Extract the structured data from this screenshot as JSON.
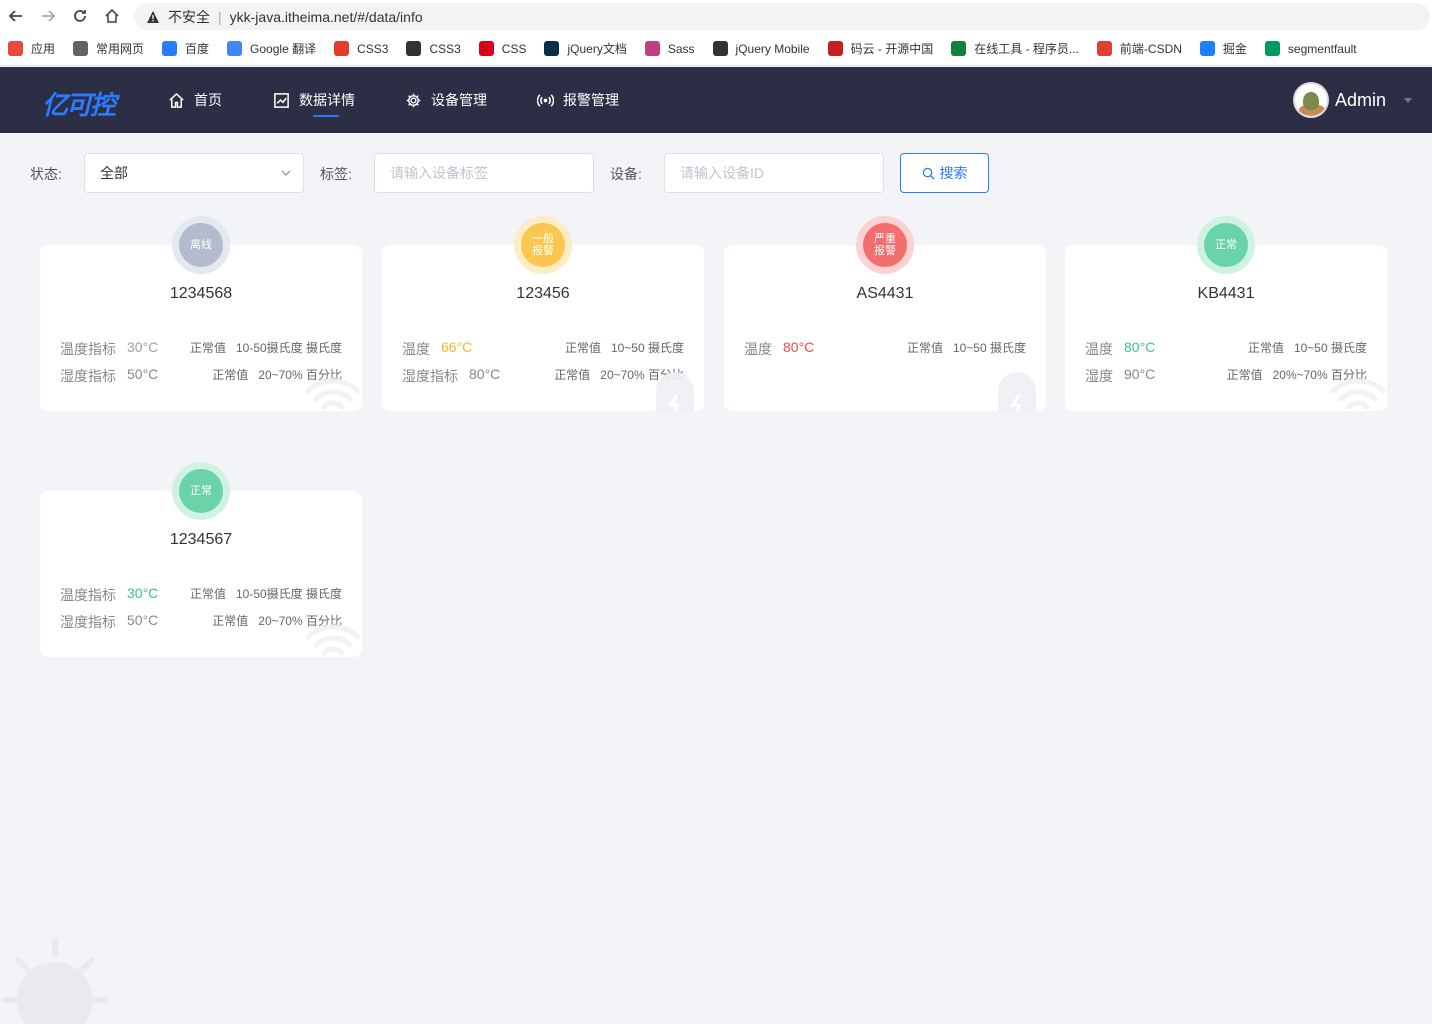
{
  "browser": {
    "insecure_label": "不安全",
    "url": "ykk-java.itheima.net/#/data/info",
    "bookmarks": [
      {
        "label": "应用",
        "icon": "apps-grid-icon",
        "color": "#e84a3c"
      },
      {
        "label": "常用网页",
        "icon": "folder-icon",
        "color": "#5f6368"
      },
      {
        "label": "百度",
        "icon": "baidu-paw-icon",
        "color": "#2a7bff"
      },
      {
        "label": "Google 翻译",
        "icon": "google-translate-icon",
        "color": "#4285f4"
      },
      {
        "label": "CSS3",
        "icon": "html5-icon",
        "color": "#e43b2c"
      },
      {
        "label": "CSS3",
        "icon": "globe-icon",
        "color": "#333333"
      },
      {
        "label": "CSS",
        "icon": "b-logo-icon",
        "color": "#d8001a"
      },
      {
        "label": "jQuery文档",
        "icon": "jquery-icon",
        "color": "#0b2d4a"
      },
      {
        "label": "Sass",
        "icon": "sass-icon",
        "color": "#bf4080"
      },
      {
        "label": "jQuery Mobile",
        "icon": "globe-icon",
        "color": "#333333"
      },
      {
        "label": "码云 - 开源中国",
        "icon": "gitee-icon",
        "color": "#c71d23"
      },
      {
        "label": "在线工具 - 程序员...",
        "icon": "tool-icon",
        "color": "#11823b"
      },
      {
        "label": "前端-CSDN",
        "icon": "csdn-icon",
        "color": "#e33e33"
      },
      {
        "label": "掘金",
        "icon": "juejin-icon",
        "color": "#1e80ff"
      },
      {
        "label": "segmentfault",
        "icon": "sf-icon",
        "color": "#009a61"
      }
    ]
  },
  "header": {
    "logo": "亿可控",
    "nav": [
      {
        "label": "首页",
        "icon": "home-icon"
      },
      {
        "label": "数据详情",
        "icon": "chart-icon",
        "active": true
      },
      {
        "label": "设备管理",
        "icon": "gear-icon"
      },
      {
        "label": "报警管理",
        "icon": "broadcast-icon"
      }
    ],
    "user": "Admin"
  },
  "filters": {
    "status_label": "状态:",
    "status_value": "全部",
    "tag_label": "标签:",
    "tag_placeholder": "请输入设备标签",
    "device_label": "设备:",
    "device_placeholder": "请输入设备ID",
    "search_label": "搜索"
  },
  "cards": [
    {
      "status": "离线",
      "badge_color": "#b3bccc",
      "ring_color": "#e4e8ef",
      "title": "1234568",
      "rows": [
        {
          "label": "温度指标",
          "value": "30°C",
          "value_color": "#9aa0ab",
          "normal_label": "正常值",
          "normal_range": "10-50摄氏度 摄氏度"
        },
        {
          "label": "湿度指标",
          "value": "50°C",
          "value_color": "#888888",
          "normal_label": "正常值",
          "normal_range": "20~70% 百分比"
        }
      ]
    },
    {
      "status": "一般 报警",
      "badge_color": "#f9c74f",
      "ring_color": "#fdecc4",
      "title": "123456",
      "rows": [
        {
          "label": "温度",
          "value": "66°C",
          "value_color": "#f4b728",
          "normal_label": "正常值",
          "normal_range": "10~50 摄氏度"
        },
        {
          "label": "湿度指标",
          "value": "80°C",
          "value_color": "#888888",
          "normal_label": "正常值",
          "normal_range": "20~70% 百分比"
        }
      ]
    },
    {
      "status": "严重 报警",
      "badge_color": "#f26d6d",
      "ring_color": "#fbd2d2",
      "title": "AS4431",
      "rows": [
        {
          "label": "温度",
          "value": "80°C",
          "value_color": "#ef4848",
          "normal_label": "正常值",
          "normal_range": "10~50 摄氏度"
        }
      ]
    },
    {
      "status": "正常",
      "badge_color": "#6bd3a8",
      "ring_color": "#cff2e3",
      "title": "KB4431",
      "rows": [
        {
          "label": "温度",
          "value": "80°C",
          "value_color": "#3cc08f",
          "normal_label": "正常值",
          "normal_range": "10~50 摄氏度"
        },
        {
          "label": "湿度",
          "value": "90°C",
          "value_color": "#888888",
          "normal_label": "正常值",
          "normal_range": "20%~70% 百分比"
        }
      ]
    },
    {
      "status": "正常",
      "badge_color": "#6bd3a8",
      "ring_color": "#cff2e3",
      "title": "1234567",
      "rows": [
        {
          "label": "温度指标",
          "value": "30°C",
          "value_color": "#3cc08f",
          "normal_label": "正常值",
          "normal_range": "10-50摄氏度 摄氏度"
        },
        {
          "label": "湿度指标",
          "value": "50°C",
          "value_color": "#888888",
          "normal_label": "正常值",
          "normal_range": "20~70% 百分比"
        }
      ]
    }
  ]
}
